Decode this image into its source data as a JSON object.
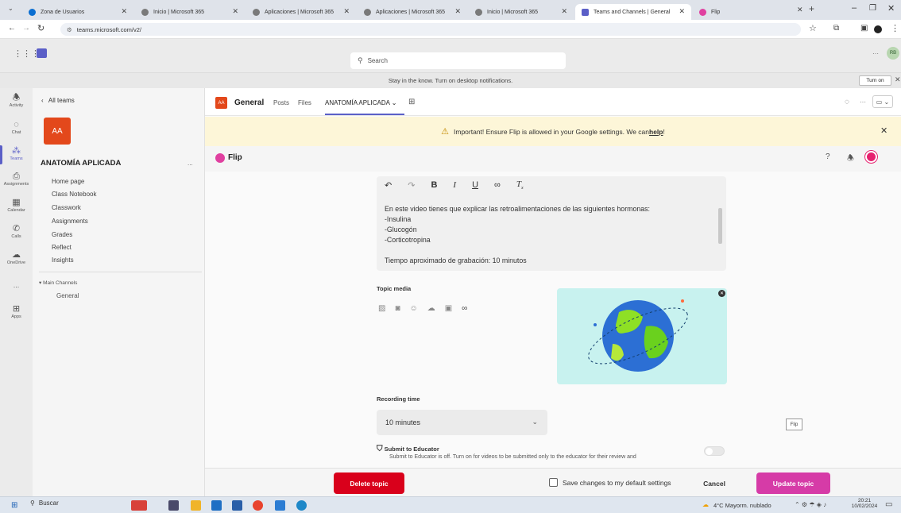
{
  "browser": {
    "tabs": [
      {
        "label": "Zona de Usuarios",
        "color": "#0a6ed1"
      },
      {
        "label": "Inicio | Microsoft 365",
        "color": "#555555"
      },
      {
        "label": "Aplicaciones | Microsoft 365",
        "color": "#555555"
      },
      {
        "label": "Aplicaciones | Microsoft 365",
        "color": "#555555"
      },
      {
        "label": "Inicio | Microsoft 365",
        "color": "#555555"
      },
      {
        "label": "Teams and Channels | General",
        "color": "#5b5fc7"
      },
      {
        "label": "Flip",
        "color": "#e040a0"
      }
    ],
    "url": "teams.microsoft.com/v2/"
  },
  "teams": {
    "search_placeholder": "Search",
    "notification": "Stay in the know. Turn on desktop notifications.",
    "turn_on": "Turn on",
    "avatar": "RB"
  },
  "rail": [
    {
      "label": "Activity",
      "icon": "bell-icon"
    },
    {
      "label": "Chat",
      "icon": "chat-icon"
    },
    {
      "label": "Teams",
      "icon": "teams-icon"
    },
    {
      "label": "Assignments",
      "icon": "assignments-icon"
    },
    {
      "label": "Calendar",
      "icon": "calendar-icon"
    },
    {
      "label": "Calls",
      "icon": "phone-icon"
    },
    {
      "label": "OneDrive",
      "icon": "cloud-icon"
    },
    {
      "label": "...",
      "icon": "more-icon"
    },
    {
      "label": "Apps",
      "icon": "apps-icon"
    }
  ],
  "sidebar": {
    "back": "All teams",
    "team_initials": "AA",
    "team_name": "ANATOMÍA APLICADA",
    "more": "...",
    "items": [
      "Home page",
      "Class Notebook",
      "Classwork",
      "Assignments",
      "Grades",
      "Reflect",
      "Insights"
    ],
    "section": "Main Channels",
    "channel": "General"
  },
  "channel": {
    "badge": "AA",
    "name": "General",
    "tabs": [
      "Posts",
      "Files",
      "ANATOMÍA APLICADA"
    ],
    "warning_pre": "Important! Ensure Flip is allowed in your Google settings. We can ",
    "warning_link": "help",
    "warning_post": "!"
  },
  "flip": {
    "title": "Flip",
    "description": "En este video tienes que explicar las retroalimentaciones de las siguientes hormonas:\n-Insulina\n-Glucogón\n-Corticotropina\n\nTiempo aproximado de grabación: 10 minutos",
    "topic_media_label": "Topic media",
    "recording_label": "Recording time",
    "recording_value": "10 minutes",
    "submit_label": "Submit to Educator",
    "submit_desc": "Submit to Educator is off. Turn on for videos to be submitted only to the educator for their review and",
    "flip_tag": "Flip"
  },
  "footer": {
    "delete": "Delete topic",
    "save_default": "Save changes to my default settings",
    "cancel": "Cancel",
    "update": "Update topic"
  },
  "taskbar": {
    "search": "Buscar",
    "weather": "4°C  Mayorm. nublado",
    "time": "20:21",
    "date": "10/02/2024"
  }
}
